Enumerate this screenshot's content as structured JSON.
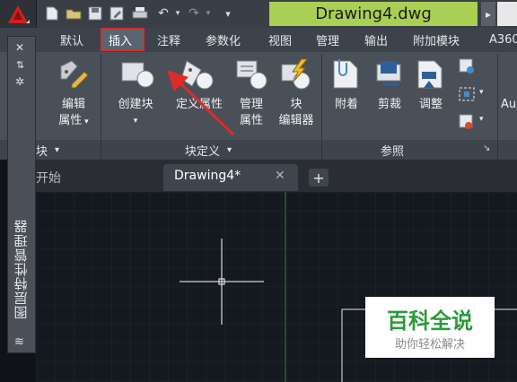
{
  "window": {
    "title": "Drawing4.dwg"
  },
  "quick_access": [
    "new-icon",
    "open-icon",
    "save-icon",
    "saveas-icon",
    "print-icon",
    "undo-icon",
    "redo-icon",
    "customize-icon"
  ],
  "ribbon_tabs": [
    "默认",
    "插入",
    "注释",
    "参数化",
    "视图",
    "管理",
    "输出",
    "附加模块",
    "A360"
  ],
  "ribbon": {
    "block_panel": {
      "edit_attr_1": "编辑",
      "edit_attr_2": "属性",
      "label": "块"
    },
    "block_def_panel": {
      "create_block": "创建块",
      "define_attr": "定义属性",
      "manage_attr_1": "管理",
      "manage_attr_2": "属性",
      "block_editor_1": "块",
      "block_editor_2": "编辑器",
      "label": "块定义"
    },
    "reference_panel": {
      "attach": "附着",
      "clip": "剪裁",
      "adjust": "调整",
      "label": "参照",
      "au": "Au"
    }
  },
  "file_tabs": {
    "start": "开始",
    "current": "Drawing4*"
  },
  "palette": {
    "title": "图层特性管理器"
  },
  "watermark": {
    "title": "百科全说",
    "subtitle": "助你轻松解决"
  },
  "colors": {
    "highlight_box": "#e02a2a",
    "title_bg": "#a9cf54",
    "watermark_green": "#2a9a3a"
  }
}
